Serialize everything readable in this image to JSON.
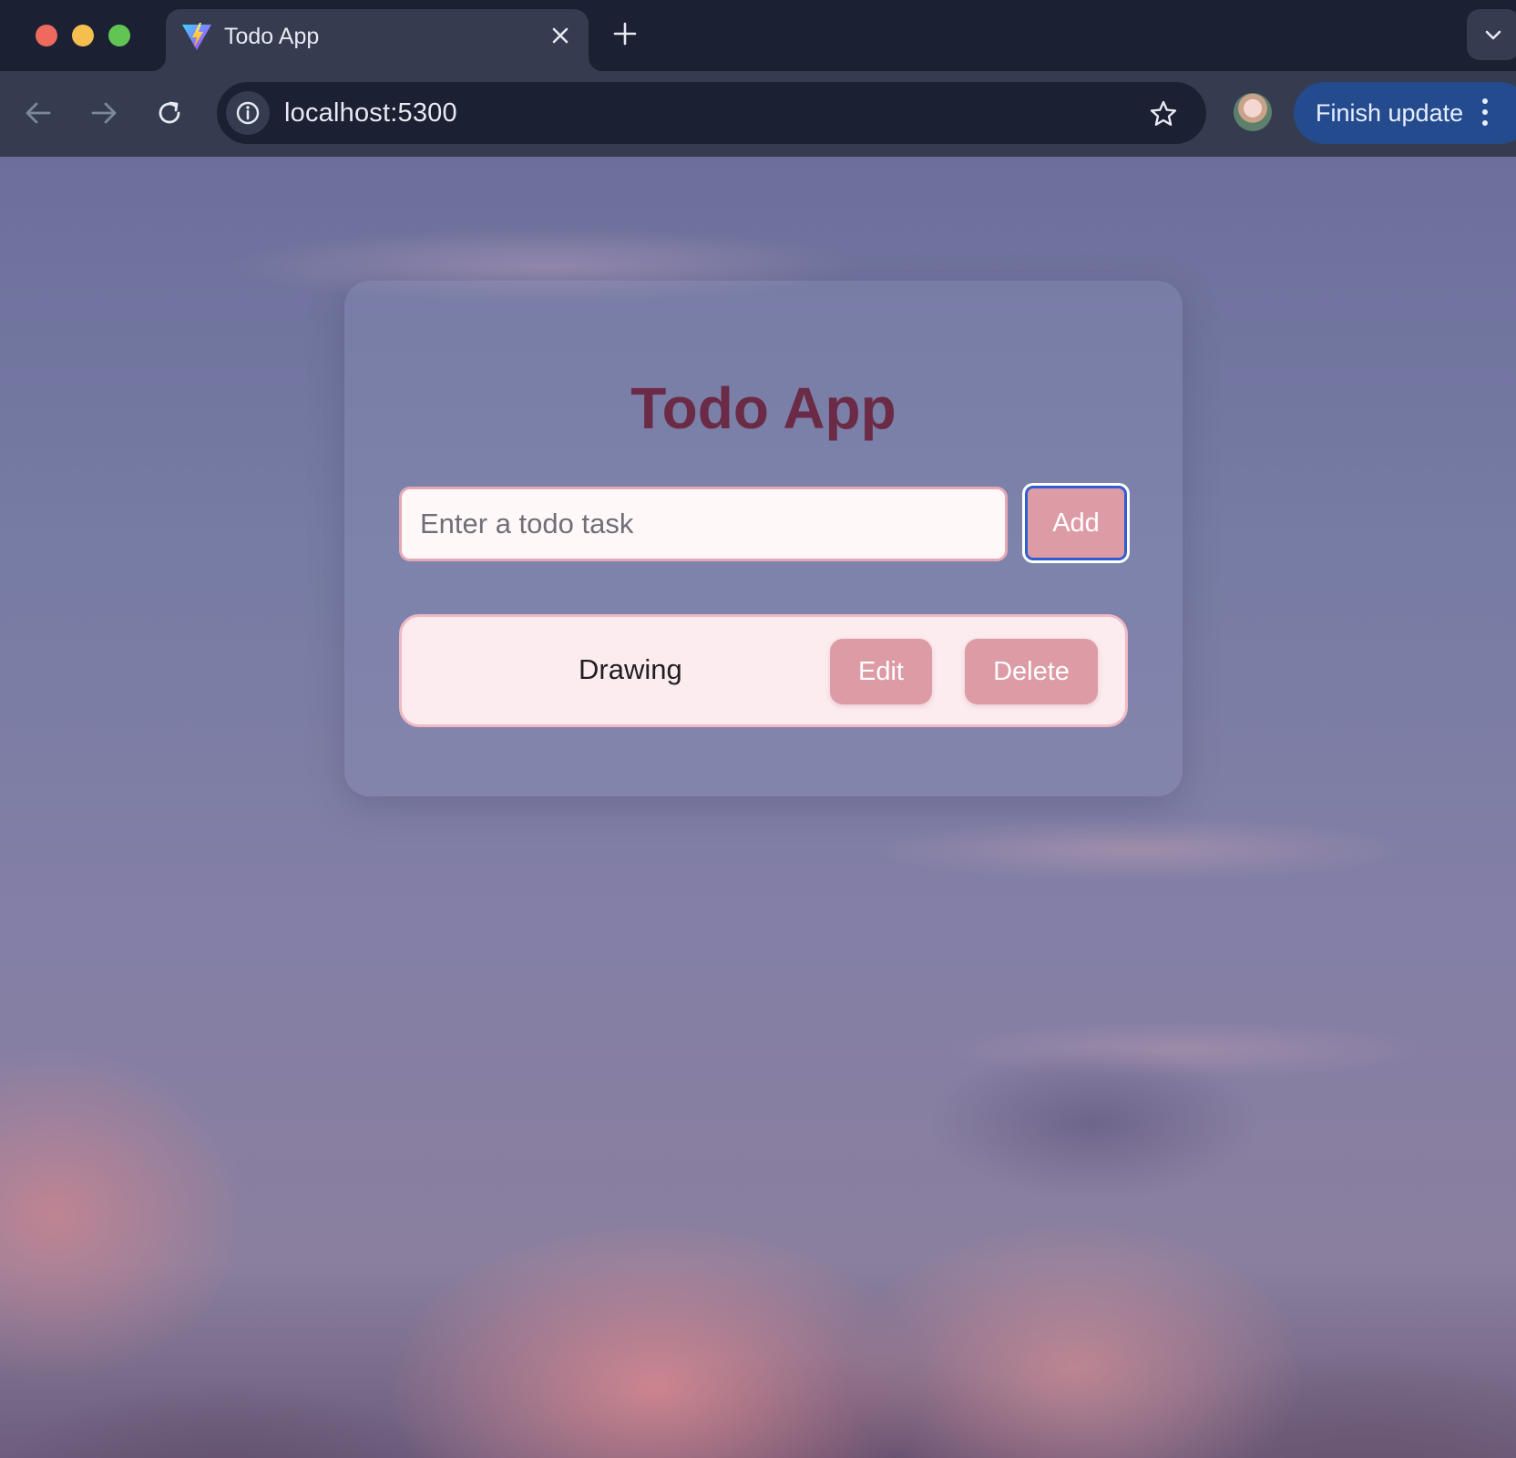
{
  "browser": {
    "tab": {
      "title": "Todo App",
      "favicon": "vite-icon"
    },
    "address_bar": {
      "url": "localhost:5300"
    },
    "finish_update_label": "Finish update"
  },
  "app": {
    "title": "Todo App",
    "input": {
      "value": "",
      "placeholder": "Enter a todo task"
    },
    "add_label": "Add",
    "todos": [
      {
        "text": "Drawing",
        "edit_label": "Edit",
        "delete_label": "Delete"
      }
    ]
  },
  "colors": {
    "title": "#6b2a45",
    "button": "#dd9ba6",
    "focus_ring": "#2f5fcf",
    "update_button": "#244b8e"
  }
}
